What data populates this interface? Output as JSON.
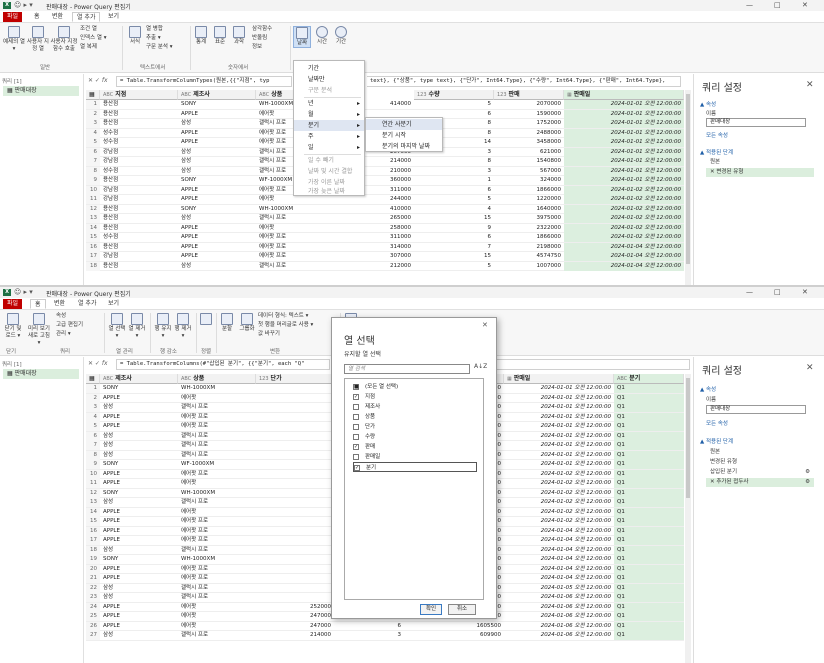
{
  "window": {
    "title": "판매대장 - Power Query 편집기",
    "minimize": "—",
    "maximize": "□",
    "close": "✕"
  },
  "top": {
    "tabs": [
      "파일",
      "홈",
      "변환",
      "열 추가",
      "보기"
    ],
    "ribbon_buttons": [
      "예제의 열 ▾",
      "사용자 지정 열",
      "사용자 지정 함수 호출",
      "조건 열",
      "인덱스 열 ▾",
      "열 복제",
      "서식",
      "열 병합",
      "추출 ▾",
      "구문 분석 ▾",
      "통계",
      "표준",
      "과학",
      "삼각함수",
      "반올림",
      "정보",
      "날짜",
      "시간",
      "기간"
    ],
    "ribbon_groups": [
      "일반",
      "텍스트에서",
      "숫자에서"
    ],
    "left_header": "쿼리 [1]",
    "query_name": "판매대장",
    "formula": "= Table.TransformColumnTypes(원본,{{\"지점\", type text}, {\"제조사\", type text}, {\"상품\", type text}, {\"단가\", Int64.Type}, {\"수량\", Int64.Type}, {\"판매\", Int64.Type}, {\"판매일\", Int64.Type},",
    "formula_prefix": "= Table.TransformColumnTypes(원본,{{\"지점\", typ",
    "formula_suffix": "text}, {\"상품\", type text}, {\"단가\", Int64.Type}, {\"수량\", Int64.Type}, {\"판매\", Int64.Type},",
    "columns": [
      "지점",
      "제조사",
      "상품",
      "수량",
      "판매",
      "판매일"
    ],
    "rows": [
      [
        "1",
        "용산점",
        "SONY",
        "WH-1000XM",
        "414000",
        "5",
        "2070000",
        "2024-01-01 오전 12:00:00"
      ],
      [
        "2",
        "용산점",
        "APPLE",
        "에어팟",
        "",
        "6",
        "1590000",
        "2024-01-01 오전 12:00:00"
      ],
      [
        "3",
        "용산점",
        "삼성",
        "갤럭시 프로",
        "",
        "8",
        "1752000",
        "2024-01-01 오전 12:00:00"
      ],
      [
        "4",
        "성수점",
        "APPLE",
        "에어팟 프로",
        "",
        "8",
        "2488000",
        "2024-01-01 오전 12:00:00"
      ],
      [
        "5",
        "성수점",
        "APPLE",
        "에어팟 프로",
        "",
        "14",
        "3458000",
        "2024-01-01 오전 12:00:00"
      ],
      [
        "6",
        "강남점",
        "삼성",
        "갤럭시 프로",
        "207000",
        "3",
        "621000",
        "2024-01-01 오전 12:00:00"
      ],
      [
        "7",
        "강남점",
        "삼성",
        "갤럭시 프로",
        "214000",
        "8",
        "1540800",
        "2024-01-01 오전 12:00:00"
      ],
      [
        "8",
        "성수점",
        "삼성",
        "갤럭시 프로",
        "210000",
        "3",
        "567000",
        "2024-01-01 오전 12:00:00"
      ],
      [
        "9",
        "용산점",
        "SONY",
        "WF-1000XM",
        "360000",
        "1",
        "324000",
        "2024-01-01 오전 12:00:00"
      ],
      [
        "10",
        "강남점",
        "APPLE",
        "에어팟 프로",
        "311000",
        "6",
        "1866000",
        "2024-01-02 오전 12:00:00"
      ],
      [
        "11",
        "강남점",
        "APPLE",
        "에어팟",
        "244000",
        "5",
        "1220000",
        "2024-01-02 오전 12:00:00"
      ],
      [
        "12",
        "용산점",
        "SONY",
        "WH-1000XM",
        "410000",
        "4",
        "1640000",
        "2024-01-02 오전 12:00:00"
      ],
      [
        "13",
        "용산점",
        "삼성",
        "갤럭시 프로",
        "265000",
        "15",
        "3975000",
        "2024-01-02 오전 12:00:00"
      ],
      [
        "14",
        "용산점",
        "APPLE",
        "에어팟",
        "258000",
        "9",
        "2322000",
        "2024-01-02 오전 12:00:00"
      ],
      [
        "15",
        "성수점",
        "APPLE",
        "에어팟 프로",
        "311000",
        "6",
        "1866000",
        "2024-01-02 오전 12:00:00"
      ],
      [
        "16",
        "용산점",
        "APPLE",
        "에어팟 프로",
        "314000",
        "7",
        "2198000",
        "2024-01-04 오전 12:00:00"
      ],
      [
        "17",
        "강남점",
        "APPLE",
        "에어팟 프로",
        "307000",
        "15",
        "4574750",
        "2024-01-04 오전 12:00:00"
      ],
      [
        "18",
        "용산점",
        "삼성",
        "갤럭시 프로",
        "212000",
        "5",
        "1007000",
        "2024-01-04 오전 12:00:00"
      ]
    ],
    "date_menu": {
      "items": [
        "기간",
        "날짜만",
        "구문 분석",
        "년",
        "월",
        "분기",
        "주",
        "일",
        "일 수 빼기",
        "날짜 및 시간 결합",
        "가장 이른 날짜",
        "가장 늦은 날짜"
      ]
    },
    "quarter_menu": {
      "items": [
        "연간 사분기",
        "분기 시작",
        "분기의 마지막 날짜"
      ]
    },
    "settings": {
      "title": "쿼리 설정",
      "props": "▲ 속성",
      "name_label": "이름",
      "name_value": "판매대장",
      "all_props": "모든 속성",
      "steps_header": "▲ 적용된 단계",
      "steps": [
        "원본",
        "변경된 유형"
      ]
    }
  },
  "bottom": {
    "tabs": [
      "파일",
      "홈",
      "변환",
      "열 추가",
      "보기"
    ],
    "ribbon_buttons": [
      "닫기 및 로드 ▾",
      "미리 보기 새로 고침 ▾",
      "속성",
      "고급 편집기",
      "관리 ▾",
      "열 선택 ▾",
      "열 제거 ▾",
      "행 유지 ▾",
      "행 제거 ▾",
      "분할",
      "그룹화",
      "데이터 형식: 텍스트 ▾",
      "첫 행을 머리글로 사용 ▾",
      "값 바꾸기",
      "결합",
      "매개 변수 관리 ▾",
      "데이터 원본 설정",
      "새 원본 ▾"
    ],
    "ribbon_groups": [
      "닫기",
      "쿼리",
      "열 관리",
      "행 감소",
      "정렬",
      "변환"
    ],
    "left_header": "쿼리 [1]",
    "query_name": "판매대장",
    "formula_prefix": "= Table.TransformColumns(#\"삽입된 분기\", {{\"분기\", each \"Q\"",
    "columns": [
      "제조사",
      "상품",
      "단가",
      "판매",
      "판매일",
      "분기"
    ],
    "rows": [
      [
        "1",
        "SONY",
        "WH-1000XM",
        "",
        "2070000",
        "2024-01-01 오전 12:00:00",
        "Q1"
      ],
      [
        "2",
        "APPLE",
        "에어팟",
        "",
        "1590000",
        "2024-01-01 오전 12:00:00",
        "Q1"
      ],
      [
        "3",
        "삼성",
        "갤럭시 프로",
        "",
        "1752000",
        "2024-01-01 오전 12:00:00",
        "Q1"
      ],
      [
        "4",
        "APPLE",
        "에어팟 프로",
        "",
        "2488000",
        "2024-01-01 오전 12:00:00",
        "Q1"
      ],
      [
        "5",
        "APPLE",
        "에어팟 프로",
        "",
        "3458000",
        "2024-01-01 오전 12:00:00",
        "Q1"
      ],
      [
        "6",
        "삼성",
        "갤럭시 프로",
        "",
        "621000",
        "2024-01-01 오전 12:00:00",
        "Q1"
      ],
      [
        "7",
        "삼성",
        "갤럭시 프로",
        "",
        "1540800",
        "2024-01-01 오전 12:00:00",
        "Q1"
      ],
      [
        "8",
        "삼성",
        "갤럭시 프로",
        "",
        "567000",
        "2024-01-01 오전 12:00:00",
        "Q1"
      ],
      [
        "9",
        "SONY",
        "WF-1000XM",
        "",
        "324000",
        "2024-01-01 오전 12:00:00",
        "Q1"
      ],
      [
        "10",
        "APPLE",
        "에어팟 프로",
        "",
        "1866000",
        "2024-01-02 오전 12:00:00",
        "Q1"
      ],
      [
        "11",
        "APPLE",
        "에어팟",
        "",
        "1220000",
        "2024-01-02 오전 12:00:00",
        "Q1"
      ],
      [
        "12",
        "SONY",
        "WH-1000XM",
        "",
        "1640000",
        "2024-01-02 오전 12:00:00",
        "Q1"
      ],
      [
        "13",
        "삼성",
        "갤럭시 프로",
        "",
        "3975000",
        "2024-01-02 오전 12:00:00",
        "Q1"
      ],
      [
        "14",
        "APPLE",
        "에어팟",
        "",
        "2322000",
        "2024-01-02 오전 12:00:00",
        "Q1"
      ],
      [
        "15",
        "APPLE",
        "에어팟 프로",
        "",
        "1866000",
        "2024-01-02 오전 12:00:00",
        "Q1"
      ],
      [
        "16",
        "APPLE",
        "에어팟 프로",
        "",
        "2198000",
        "2024-01-04 오전 12:00:00",
        "Q1"
      ],
      [
        "17",
        "APPLE",
        "에어팟 프로",
        "",
        "4574750",
        "2024-01-04 오전 12:00:00",
        "Q1"
      ],
      [
        "18",
        "삼성",
        "갤럭시 프로",
        "",
        "1007000",
        "2024-01-04 오전 12:00:00",
        "Q1"
      ],
      [
        "19",
        "SONY",
        "WH-1000XM",
        "",
        "1676000",
        "2024-01-04 오전 12:00:00",
        "Q1"
      ],
      [
        "20",
        "APPLE",
        "에어팟 프로",
        "",
        "2983000",
        "2024-01-04 오전 12:00:00",
        "Q1"
      ],
      [
        "21",
        "APPLE",
        "에어팟 프로",
        "",
        "2346500",
        "2024-01-04 오전 12:00:00",
        "Q1"
      ],
      [
        "22",
        "삼성",
        "갤럭시 프로",
        "",
        "604200",
        "2024-01-05 오전 12:00:00",
        "Q1"
      ],
      [
        "23",
        "삼성",
        "갤럭시 프로",
        "",
        "1208400",
        "2024-01-06 오전 12:00:00",
        "Q1"
      ],
      [
        "24",
        "APPLE",
        "에어팟",
        "252000",
        "3112200",
        "2024-01-06 오전 12:00:00",
        "Q1"
      ],
      [
        "25",
        "APPLE",
        "에어팟",
        "247000",
        "3519750",
        "2024-01-06 오전 12:00:00",
        "Q1"
      ],
      [
        "26",
        "APPLE",
        "에어팟",
        "247000",
        "1605500",
        "2024-01-06 오전 12:00:00",
        "Q1"
      ],
      [
        "27",
        "삼성",
        "갤럭시 프로",
        "214000",
        "609900",
        "2024-01-06 오전 12:00:00",
        "Q1"
      ]
    ],
    "qty_column": [
      "",
      "",
      "",
      "",
      "",
      "",
      "",
      "",
      "",
      "",
      "",
      "",
      "",
      "",
      "",
      "",
      "",
      "",
      "",
      "",
      "",
      "",
      "",
      "13",
      "15",
      "6",
      "3"
    ],
    "dialog": {
      "title": "열 선택",
      "subtitle": "유지할 열 선택",
      "search_placeholder": "열 검색",
      "sort_icon": "A↓Z",
      "items": [
        {
          "label": "(모든 열 선택)",
          "checked": "■"
        },
        {
          "label": "지점",
          "checked": "✓"
        },
        {
          "label": "제조사",
          "checked": ""
        },
        {
          "label": "상품",
          "checked": ""
        },
        {
          "label": "단가",
          "checked": ""
        },
        {
          "label": "수량",
          "checked": ""
        },
        {
          "label": "판매",
          "checked": "✓"
        },
        {
          "label": "판매일",
          "checked": ""
        },
        {
          "label": "분기",
          "checked": "✓"
        }
      ],
      "ok": "확인",
      "cancel": "취소"
    },
    "settings": {
      "title": "쿼리 설정",
      "props": "▲ 속성",
      "name_label": "이름",
      "name_value": "판매대장",
      "all_props": "모든 속성",
      "steps_header": "▲ 적용된 단계",
      "steps": [
        "원본",
        "변경된 유형",
        "삽입된 분기",
        "추가된 접두사"
      ],
      "gear": "⚙"
    }
  },
  "colors": {
    "file_tab": "#c00000",
    "selected_col": "#dcefdf",
    "link": "#1f5fa8"
  }
}
